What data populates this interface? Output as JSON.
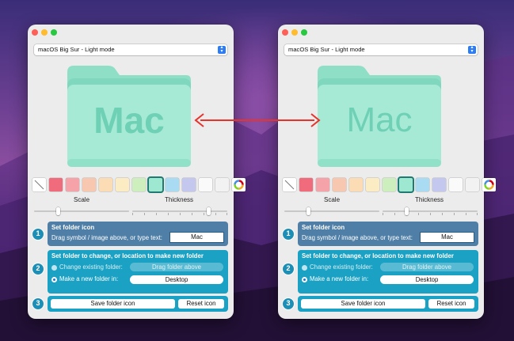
{
  "windows": [
    {
      "id": "left",
      "theme_select": "macOS Big Sur - Light mode",
      "folder_text": "Mac",
      "sliders": {
        "scale_label": "Scale",
        "thickness_label": "Thickness",
        "scale_value": 0.25,
        "thickness_value": 0.8
      },
      "step1": {
        "number": "1",
        "title": "Set folder icon",
        "subtitle": "Drag symbol / image above, or type text:",
        "text_value": "Mac"
      },
      "step2": {
        "number": "2",
        "title": "Set folder to change, or location to make new folder",
        "change_label": "Change existing folder:",
        "drag_placeholder": "Drag folder above",
        "new_label": "Make a new folder in:",
        "location": "Desktop"
      },
      "step3": {
        "number": "3",
        "save_label": "Save folder icon",
        "reset_label": "Reset icon"
      }
    },
    {
      "id": "right",
      "theme_select": "macOS Big Sur - Light mode",
      "folder_text": "Mac",
      "sliders": {
        "scale_label": "Scale",
        "thickness_label": "Thickness",
        "scale_value": 0.25,
        "thickness_value": 0.25
      },
      "step1": {
        "number": "1",
        "title": "Set folder icon",
        "subtitle": "Drag symbol / image above, or type text:",
        "text_value": "Mac"
      },
      "step2": {
        "number": "2",
        "title": "Set folder to change, or location to make new folder",
        "change_label": "Change existing folder:",
        "drag_placeholder": "Drag folder above",
        "new_label": "Make a new folder in:",
        "location": "Desktop"
      },
      "step3": {
        "number": "3",
        "save_label": "Save folder icon",
        "reset_label": "Reset icon"
      }
    }
  ],
  "swatches": [
    {
      "name": "no-color-swatch",
      "color": "#ffffff",
      "kind": "none"
    },
    {
      "name": "red-swatch",
      "color": "#f06b7b"
    },
    {
      "name": "salmon-swatch",
      "color": "#f5a3a8"
    },
    {
      "name": "peach-swatch",
      "color": "#f8c7b0"
    },
    {
      "name": "orange-swatch",
      "color": "#fbdcb5"
    },
    {
      "name": "yellow-swatch",
      "color": "#fbecc3"
    },
    {
      "name": "green-swatch",
      "color": "#cdeebd"
    },
    {
      "name": "mint-swatch",
      "color": "#9ee8d1",
      "selected": true
    },
    {
      "name": "sky-swatch",
      "color": "#a9dcf2"
    },
    {
      "name": "lavender-swatch",
      "color": "#c4c8ee"
    },
    {
      "name": "white-swatch",
      "color": "#fafafa"
    },
    {
      "name": "light-gray-swatch",
      "color": "#f2f2f2"
    },
    {
      "name": "color-wheel-swatch",
      "color": "#ffffff",
      "kind": "wheel"
    }
  ],
  "colors": {
    "folder_front": "#a6ead5",
    "folder_back": "#7fd8bd",
    "folder_tab": "#8fdfc6",
    "step1_bg": "#4f7fa6",
    "step_bg": "#1aa1c3",
    "arrow": "#e8322a"
  }
}
